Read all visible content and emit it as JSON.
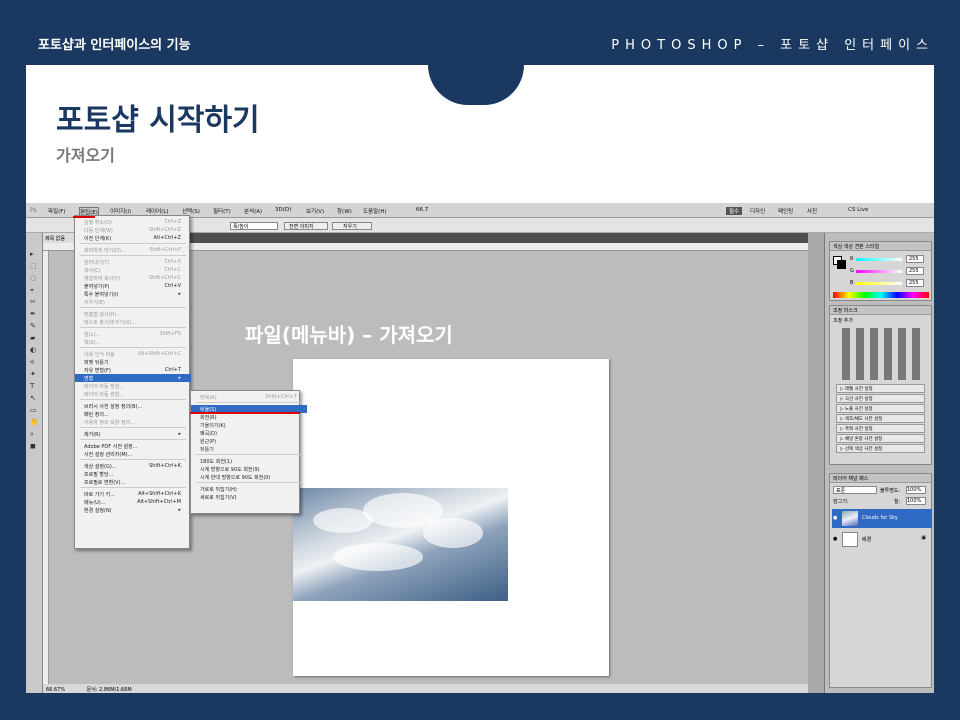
{
  "header": {
    "left": "포토샵과 인터페이스의 기능",
    "right": "PHOTOSHOP – 포토샵 인터페이스"
  },
  "slide": {
    "title": "포토샵 시작하기",
    "subtitle": "가져오기",
    "caption": "파일(메뉴바) – 가져오기"
  },
  "menubar": [
    "파일(F)",
    "편집(E)",
    "이미지(I)",
    "레이어(L)",
    "선택(S)",
    "필터(T)",
    "분석(A)",
    "3D(D)",
    "보기(V)",
    "창(W)",
    "도움말(H)"
  ],
  "menubar_right": {
    "zoom": "66.7",
    "essentials": "필수",
    "design": "디자인",
    "paint": "페인팅",
    "photo": "사진",
    "cslive": "CS Live"
  },
  "options": {
    "style": "폭/높이",
    "front_image": "전면 이미지",
    "clear": "지우기"
  },
  "edit_menu": [
    {
      "label": "실행 취소(O)",
      "sc": "Ctrl+Z",
      "dis": true
    },
    {
      "label": "다음 단계(W)",
      "sc": "Shift+Ctrl+Z",
      "dis": true
    },
    {
      "label": "이전 단계(K)",
      "sc": "Alt+Ctrl+Z"
    },
    {
      "sep": true
    },
    {
      "label": "희미하게 하기(D)...",
      "sc": "Shift+Ctrl+F",
      "dis": true
    },
    {
      "sep": true
    },
    {
      "label": "잘라내기(T)",
      "sc": "Ctrl+X",
      "dis": true
    },
    {
      "label": "복사(C)",
      "sc": "Ctrl+C",
      "dis": true
    },
    {
      "label": "병합하여 복사(Y)",
      "sc": "Shift+Ctrl+C",
      "dis": true
    },
    {
      "label": "붙여넣기(P)",
      "sc": "Ctrl+V"
    },
    {
      "label": "특수 붙여넣기(I)",
      "sc": "▸"
    },
    {
      "label": "지우기(E)",
      "dis": true
    },
    {
      "sep": true
    },
    {
      "label": "맞춤법 검사(H)...",
      "dis": true
    },
    {
      "label": "텍스트 찾기/바꾸기(X)...",
      "dis": true
    },
    {
      "sep": true
    },
    {
      "label": "칠(L)...",
      "sc": "Shift+F5",
      "dis": true
    },
    {
      "label": "획(S)...",
      "dis": true
    },
    {
      "sep": true
    },
    {
      "label": "내용 인식 비율",
      "sc": "Alt+Shift+Ctrl+C",
      "dis": true
    },
    {
      "label": "퍼펫 뒤틀기"
    },
    {
      "label": "자유 변형(F)",
      "sc": "Ctrl+T"
    },
    {
      "label": "변형",
      "sc": "▸",
      "hl": true
    },
    {
      "label": "레이어 자동 정렬...",
      "dis": true
    },
    {
      "label": "레이어 자동 혼합...",
      "dis": true
    },
    {
      "sep": true
    },
    {
      "label": "브러시 사전 설정 정의(B)..."
    },
    {
      "label": "패턴 정의..."
    },
    {
      "label": "사용자 정의 모양 정의...",
      "dis": true
    },
    {
      "sep": true
    },
    {
      "label": "제거(R)",
      "sc": "▸"
    },
    {
      "sep": true
    },
    {
      "label": "Adobe PDF 사전 설정..."
    },
    {
      "label": "사전 설정 관리자(M)..."
    },
    {
      "sep": true
    },
    {
      "label": "색상 설정(G)...",
      "sc": "Shift+Ctrl+K"
    },
    {
      "label": "프로필 할당..."
    },
    {
      "label": "프로필로 변환(V)..."
    },
    {
      "sep": true
    },
    {
      "label": "바로 가기 키...",
      "sc": "Alt+Shift+Ctrl+K"
    },
    {
      "label": "메뉴(U)...",
      "sc": "Alt+Shift+Ctrl+M"
    },
    {
      "label": "환경 설정(N)",
      "sc": "▸"
    }
  ],
  "transform_menu": [
    {
      "label": "반복(A)",
      "sc": "Shift+Ctrl+T",
      "dis": true
    },
    {
      "sep": true
    },
    {
      "label": "비율(S)",
      "hl": true
    },
    {
      "label": "회전(R)"
    },
    {
      "label": "기울이기(K)"
    },
    {
      "label": "왜곡(D)"
    },
    {
      "label": "원근(P)"
    },
    {
      "label": "뒤틀기"
    },
    {
      "sep": true
    },
    {
      "label": "180도 회전(1)"
    },
    {
      "label": "시계 방향으로 90도 회전(9)"
    },
    {
      "label": "시계 반대 방향으로 90도 회전(0)"
    },
    {
      "sep": true
    },
    {
      "label": "가로로 뒤집기(H)"
    },
    {
      "label": "세로로 뒤집기(V)"
    }
  ],
  "color_panel": {
    "tabs": "색상  색상 견본  스타일",
    "r": "255",
    "g": "255",
    "b": "255",
    "r_label": "R",
    "g_label": "G",
    "b_label": "B"
  },
  "adjust_panel": {
    "tab": "조정  마스크",
    "title": "조정 추가",
    "presets": [
      "▷ 레벨 사전 설정",
      "▷ 곡선 사전 설정",
      "▷ 노출 사전 설정",
      "▷ 색조/채도 사전 설정",
      "▷ 흑백 사전 설정",
      "▷ 채널 혼합 사전 설정",
      "▷ 선택 색상 사전 설정"
    ]
  },
  "layers_panel": {
    "tabs": "레이어  채널  패스",
    "mode": "표준",
    "opacity_label": "불투명도:",
    "opacity": "100%",
    "lock_label": "잠그기:",
    "fill_label": "칠:",
    "fill": "100%",
    "layers": [
      "Clouds for Sky",
      "배경"
    ]
  },
  "status": {
    "zoom": "66.67%",
    "doc": "문서: 2.86M/1.66M"
  },
  "doc_tab": "제목 없음"
}
